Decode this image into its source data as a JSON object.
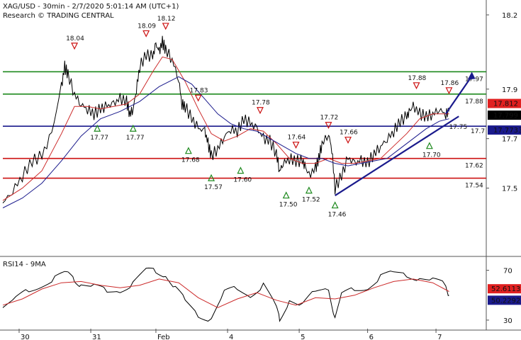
{
  "header": {
    "line1": "XAG/USD - 30min - 2/7/2020 5:01:14 AM (UTC+1)",
    "line2": "Research © TRADING CENTRAL"
  },
  "chart_data": [
    {
      "type": "line",
      "panel": "price",
      "yticks": [
        17.5,
        17.7,
        17.9,
        18.2
      ],
      "ylim": [
        17.35,
        18.22
      ],
      "x_ticks": [
        {
          "label": "30",
          "bar": 5
        },
        {
          "label": "31",
          "bar": 27
        },
        {
          "label": "Feb",
          "bar": 47
        },
        {
          "label": "4",
          "bar": 69
        },
        {
          "label": "5",
          "bar": 91
        },
        {
          "label": "6",
          "bar": 112
        },
        {
          "label": "7",
          "bar": 133
        }
      ],
      "x_range": [
        0,
        148
      ],
      "levels": [
        {
          "value": 17.97,
          "label": "17.97",
          "color": "#1f8a1f"
        },
        {
          "value": 17.88,
          "label": "17.88",
          "color": "#1f8a1f"
        },
        {
          "value": 17.75,
          "label": "17.75",
          "color": "#1a1a8c",
          "axis_label": "17.7"
        },
        {
          "value": 17.62,
          "label": "17.62",
          "color": "#cc1111"
        },
        {
          "value": 17.54,
          "label": "17.54",
          "color": "#cc1111"
        }
      ],
      "price_tags": [
        {
          "value": 17.812,
          "text": "17.812",
          "bg": "#e02020",
          "fg": "#ffffff"
        },
        {
          "value": 17.799,
          "text": "17.799",
          "bg": "#000000",
          "fg": "#ffffff"
        },
        {
          "value": 17.7733,
          "text": "17.7733",
          "bg": "#1a1a8c",
          "fg": "#ffffff"
        }
      ],
      "series": [
        {
          "role": "close",
          "color": "#000000",
          "x": [
            0,
            3,
            6,
            9,
            12,
            15,
            18,
            19,
            20,
            22,
            24,
            26,
            28,
            30,
            32,
            34,
            36,
            38,
            39,
            40,
            41,
            42,
            44,
            46,
            47,
            48,
            49,
            50,
            52,
            54,
            55,
            56,
            58,
            60,
            62,
            63,
            64,
            66,
            68,
            70,
            72,
            74,
            76,
            78,
            80,
            82,
            84,
            85,
            86,
            88,
            90,
            92,
            93,
            94,
            96,
            97,
            98,
            100,
            101,
            102,
            104,
            106,
            108,
            110,
            112,
            114,
            116,
            118,
            120,
            122,
            124,
            125,
            126,
            128,
            130,
            132,
            134,
            136,
            137
          ],
          "y": [
            17.44,
            17.49,
            17.55,
            17.61,
            17.63,
            17.72,
            17.91,
            17.99,
            17.96,
            17.88,
            17.84,
            17.82,
            17.8,
            17.82,
            17.83,
            17.84,
            17.86,
            17.85,
            17.8,
            17.82,
            17.9,
            17.99,
            18.04,
            18.03,
            18.08,
            18.05,
            18.09,
            18.06,
            18.02,
            17.94,
            17.84,
            17.83,
            17.78,
            17.74,
            17.73,
            17.68,
            17.63,
            17.66,
            17.71,
            17.74,
            17.73,
            17.78,
            17.76,
            17.74,
            17.7,
            17.69,
            17.64,
            17.57,
            17.6,
            17.62,
            17.61,
            17.61,
            17.58,
            17.55,
            17.58,
            17.62,
            17.68,
            17.72,
            17.66,
            17.5,
            17.55,
            17.62,
            17.6,
            17.61,
            17.6,
            17.64,
            17.67,
            17.7,
            17.73,
            17.77,
            17.79,
            17.81,
            17.83,
            17.8,
            17.79,
            17.8,
            17.82,
            17.8,
            17.81
          ]
        },
        {
          "role": "fast-ma",
          "color": "#cc2a2a",
          "x": [
            0,
            6,
            12,
            18,
            22,
            26,
            30,
            34,
            38,
            42,
            46,
            49,
            52,
            56,
            60,
            64,
            68,
            72,
            76,
            80,
            84,
            88,
            92,
            96,
            100,
            104,
            108,
            112,
            116,
            120,
            124,
            128,
            132,
            137
          ],
          "y": [
            17.45,
            17.5,
            17.57,
            17.72,
            17.83,
            17.83,
            17.82,
            17.83,
            17.84,
            17.88,
            17.97,
            18.03,
            18.02,
            17.93,
            17.82,
            17.72,
            17.69,
            17.71,
            17.74,
            17.73,
            17.68,
            17.62,
            17.6,
            17.6,
            17.62,
            17.6,
            17.6,
            17.61,
            17.62,
            17.67,
            17.72,
            17.78,
            17.8,
            17.8
          ]
        },
        {
          "role": "slow-ma",
          "color": "#1a1a8c",
          "x": [
            0,
            6,
            12,
            18,
            24,
            30,
            36,
            42,
            48,
            54,
            58,
            62,
            66,
            70,
            74,
            78,
            82,
            86,
            90,
            94,
            98,
            102,
            106,
            110,
            114,
            118,
            122,
            126,
            130,
            134,
            137
          ],
          "y": [
            17.42,
            17.46,
            17.52,
            17.61,
            17.71,
            17.78,
            17.81,
            17.85,
            17.91,
            17.95,
            17.92,
            17.86,
            17.8,
            17.76,
            17.74,
            17.73,
            17.7,
            17.67,
            17.64,
            17.62,
            17.62,
            17.6,
            17.59,
            17.6,
            17.61,
            17.62,
            17.66,
            17.7,
            17.74,
            17.77,
            17.78
          ]
        }
      ],
      "markers": [
        {
          "kind": "high",
          "bar": 22,
          "value": 18.04,
          "label": "18.04"
        },
        {
          "kind": "high",
          "bar": 44,
          "value": 18.09,
          "label": "18.09"
        },
        {
          "kind": "high",
          "bar": 50,
          "value": 18.12,
          "label": "18.12"
        },
        {
          "kind": "high",
          "bar": 60,
          "value": 17.83,
          "label": "17.83"
        },
        {
          "kind": "high",
          "bar": 79,
          "value": 17.78,
          "label": "17.78"
        },
        {
          "kind": "high",
          "bar": 90,
          "value": 17.64,
          "label": "17.64"
        },
        {
          "kind": "high",
          "bar": 100,
          "value": 17.72,
          "label": "17.72"
        },
        {
          "kind": "high",
          "bar": 106,
          "value": 17.66,
          "label": "17.66"
        },
        {
          "kind": "high",
          "bar": 127,
          "value": 17.88,
          "label": "17.88"
        },
        {
          "kind": "high",
          "bar": 137,
          "value": 17.86,
          "label": "17.86"
        },
        {
          "kind": "low",
          "bar": 29,
          "value": 17.77,
          "label": "17.77"
        },
        {
          "kind": "low",
          "bar": 40,
          "value": 17.77,
          "label": "17.77"
        },
        {
          "kind": "low",
          "bar": 57,
          "value": 17.68,
          "label": "17.68"
        },
        {
          "kind": "low",
          "bar": 64,
          "value": 17.57,
          "label": "17.57"
        },
        {
          "kind": "low",
          "bar": 73,
          "value": 17.6,
          "label": "17.60"
        },
        {
          "kind": "low",
          "bar": 87,
          "value": 17.5,
          "label": "17.50"
        },
        {
          "kind": "low",
          "bar": 94,
          "value": 17.52,
          "label": "17.52"
        },
        {
          "kind": "low",
          "bar": 102,
          "value": 17.46,
          "label": "17.46"
        },
        {
          "kind": "low",
          "bar": 131,
          "value": 17.7,
          "label": "17.70"
        }
      ],
      "trendline": {
        "from": {
          "bar": 102,
          "value": 17.47
        },
        "to": {
          "bar": 140,
          "value": 17.79
        },
        "color": "#1a1a8c"
      },
      "projection_arrow": {
        "from": {
          "bar": 136,
          "value": 17.8
        },
        "to": {
          "bar": 144,
          "value": 17.97
        },
        "color": "#1a1a8c"
      }
    },
    {
      "type": "line",
      "panel": "rsi",
      "title": "RSI14 - 9MA",
      "yticks": [
        30,
        70
      ],
      "ylim": [
        22,
        80
      ],
      "price_tags": [
        {
          "value": 52.6113,
          "text": "52.6113",
          "bg": "#e02020",
          "fg": "#ffffff"
        },
        {
          "value": 50.2292,
          "text": "50.2292",
          "bg": "#1a1a8c",
          "fg": "#ffffff"
        }
      ],
      "series": [
        {
          "role": "rsi",
          "color": "#000000",
          "x": [
            0,
            4,
            8,
            12,
            16,
            20,
            22,
            24,
            28,
            32,
            36,
            40,
            44,
            47,
            50,
            53,
            56,
            60,
            64,
            68,
            72,
            76,
            80,
            84,
            85,
            88,
            92,
            96,
            100,
            102,
            104,
            108,
            112,
            116,
            120,
            124,
            128,
            132,
            136,
            137
          ],
          "y": [
            40,
            45,
            54,
            60,
            63,
            66,
            64,
            60,
            55,
            52,
            56,
            60,
            68,
            70,
            68,
            54,
            44,
            36,
            32,
            50,
            55,
            52,
            58,
            38,
            32,
            48,
            40,
            52,
            58,
            32,
            48,
            55,
            58,
            64,
            66,
            68,
            65,
            60,
            57,
            50
          ]
        },
        {
          "role": "rsi-ma",
          "color": "#cc2a2a",
          "x": [
            0,
            6,
            12,
            18,
            24,
            30,
            36,
            42,
            48,
            54,
            60,
            66,
            72,
            78,
            84,
            90,
            96,
            102,
            108,
            114,
            120,
            126,
            132,
            137
          ],
          "y": [
            42,
            47,
            55,
            60,
            61,
            58,
            56,
            58,
            63,
            60,
            48,
            40,
            47,
            52,
            46,
            42,
            48,
            47,
            50,
            56,
            61,
            63,
            60,
            53
          ]
        }
      ]
    }
  ]
}
